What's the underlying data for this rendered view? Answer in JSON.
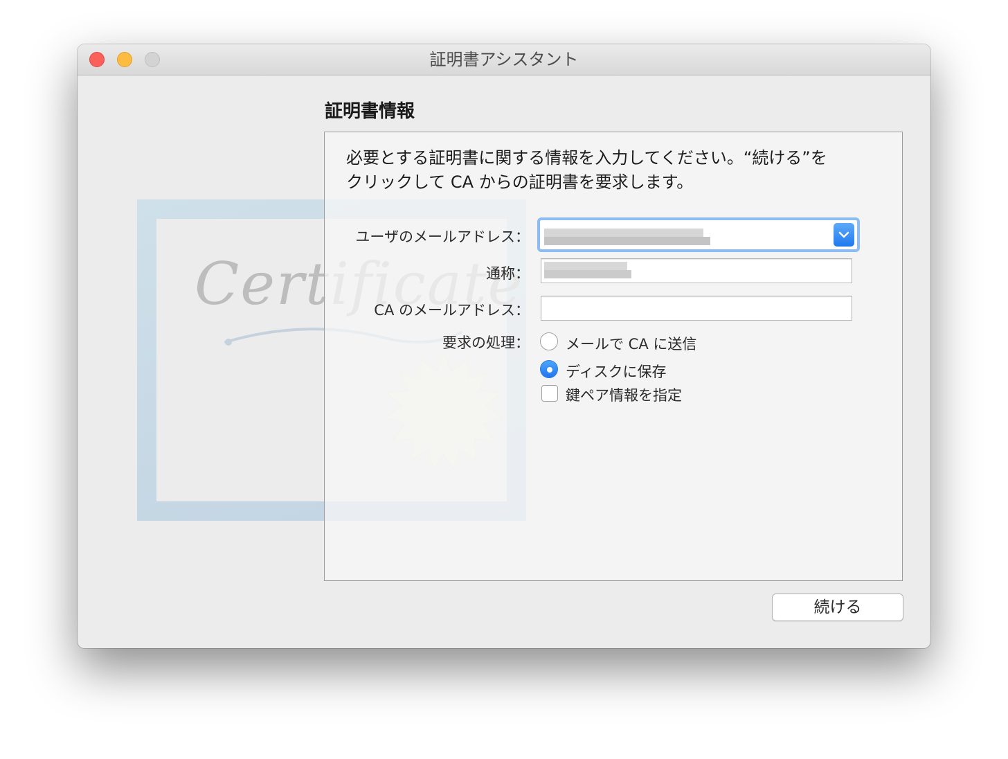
{
  "window": {
    "title": "証明書アシスタント"
  },
  "section": {
    "title": "証明書情報"
  },
  "description": {
    "line1": "必要とする証明書に関する情報を入力してください。“続ける”を",
    "line2": "クリックして CA からの証明書を要求します。"
  },
  "artwork": {
    "script_text": "Certificate"
  },
  "form": {
    "user_email": {
      "label": "ユーザのメールアドレス：",
      "value": ""
    },
    "common_name": {
      "label": "通称：",
      "value": ""
    },
    "ca_email": {
      "label": "CA のメールアドレス：",
      "value": ""
    },
    "request": {
      "label": "要求の処理：",
      "options": [
        {
          "label": "メールで CA に送信",
          "selected": false
        },
        {
          "label": "ディスクに保存",
          "selected": true
        }
      ]
    },
    "key_pair": {
      "label": "鍵ペア情報を指定",
      "checked": false
    }
  },
  "footer": {
    "continue_label": "続ける"
  },
  "colors": {
    "accent": "#2176ee",
    "focus_ring": "#8cbcf2",
    "close": "#fc605b",
    "minimize": "#fdbc40",
    "zoom_disabled": "#d3d3d3"
  },
  "icons": {
    "combo_arrow": "chevron-down-icon",
    "traffic": [
      "close-icon",
      "minimize-icon",
      "zoom-icon"
    ]
  }
}
